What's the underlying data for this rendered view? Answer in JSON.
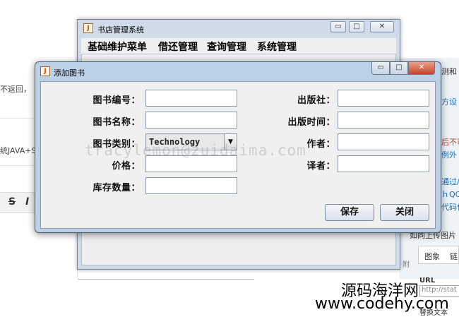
{
  "background": {
    "left_snippets": [
      "不返回，",
      "统JAVA+S"
    ],
    "toolbar_glyphs": [
      "S",
      "I"
    ],
    "right_snippets": [
      "测和",
      "方设",
      "后不可",
      "例外",
      "通过/",
      "ｈQC",
      "代码位",
      "如同上传图片"
    ],
    "tabs": [
      "图象",
      "链"
    ],
    "url_label": "URL",
    "url_value": "http://stat",
    "alt_label": "替换文本",
    "small_btn": "、附"
  },
  "main_window": {
    "title": "书店管理系统",
    "menu": [
      "基础维护菜单",
      "借还管理",
      "查询管理",
      "系统管理"
    ]
  },
  "dialog": {
    "title": "添加图书",
    "left_labels": {
      "book_no": "图书编号：",
      "book_name": "图书名称：",
      "book_category": "图书类别：",
      "price": "价格：",
      "stock": "库存数量："
    },
    "right_labels": {
      "publisher": "出版社：",
      "publish_time": "出版时间：",
      "author": "作者：",
      "translator": "译者："
    },
    "values": {
      "book_no": "",
      "book_name": "",
      "category": "Technology",
      "price": "",
      "stock": "",
      "publisher": "",
      "publish_time": "",
      "author": "",
      "translator": ""
    },
    "buttons": {
      "save": "保存",
      "close": "关闭"
    }
  },
  "watermark": "tracylemon@zuidaima.com",
  "site": {
    "brand": "源码海洋网",
    "url": "www.codehy.com"
  }
}
